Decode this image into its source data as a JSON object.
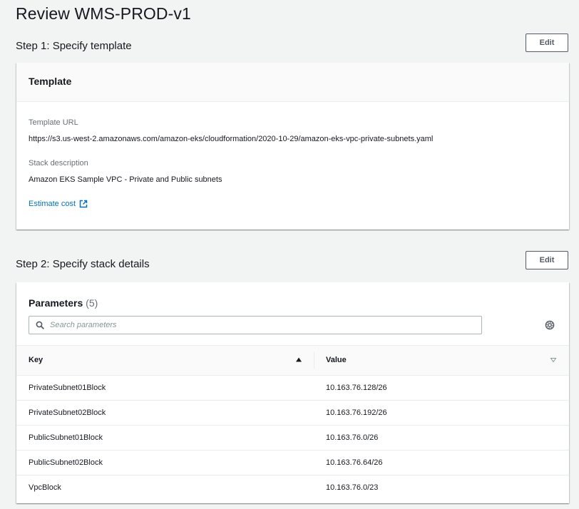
{
  "page": {
    "title": "Review WMS-PROD-v1"
  },
  "step1": {
    "title": "Step 1: Specify template",
    "edit_label": "Edit",
    "card_title": "Template",
    "template_url_label": "Template URL",
    "template_url_value": "https://s3.us-west-2.amazonaws.com/amazon-eks/cloudformation/2020-10-29/amazon-eks-vpc-private-subnets.yaml",
    "stack_description_label": "Stack description",
    "stack_description_value": "Amazon EKS Sample VPC - Private and Public subnets",
    "estimate_cost_label": "Estimate cost",
    "estimate_cost_icon": "external-link-icon"
  },
  "step2": {
    "title": "Step 2: Specify stack details",
    "edit_label": "Edit",
    "params_title": "Parameters",
    "params_count": "(5)",
    "search": {
      "placeholder": "Search parameters",
      "value": "",
      "icon": "search-icon"
    },
    "preferences_icon": "gear-icon",
    "columns": {
      "key": "Key",
      "value": "Value"
    },
    "key_sort_icon": "sort-ascending-icon",
    "value_sort_icon": "sort-unsorted-icon",
    "rows": [
      {
        "key": "PrivateSubnet01Block",
        "value": "10.163.76.128/26"
      },
      {
        "key": "PrivateSubnet02Block",
        "value": "10.163.76.192/26"
      },
      {
        "key": "PublicSubnet01Block",
        "value": "10.163.76.0/26"
      },
      {
        "key": "PublicSubnet02Block",
        "value": "10.163.76.64/26"
      },
      {
        "key": "VpcBlock",
        "value": "10.163.76.0/23"
      }
    ]
  },
  "colors": {
    "background": "#f2f3f3",
    "link": "#0073bb",
    "text": "#16191f",
    "label": "#687078",
    "border": "#eaeded"
  }
}
